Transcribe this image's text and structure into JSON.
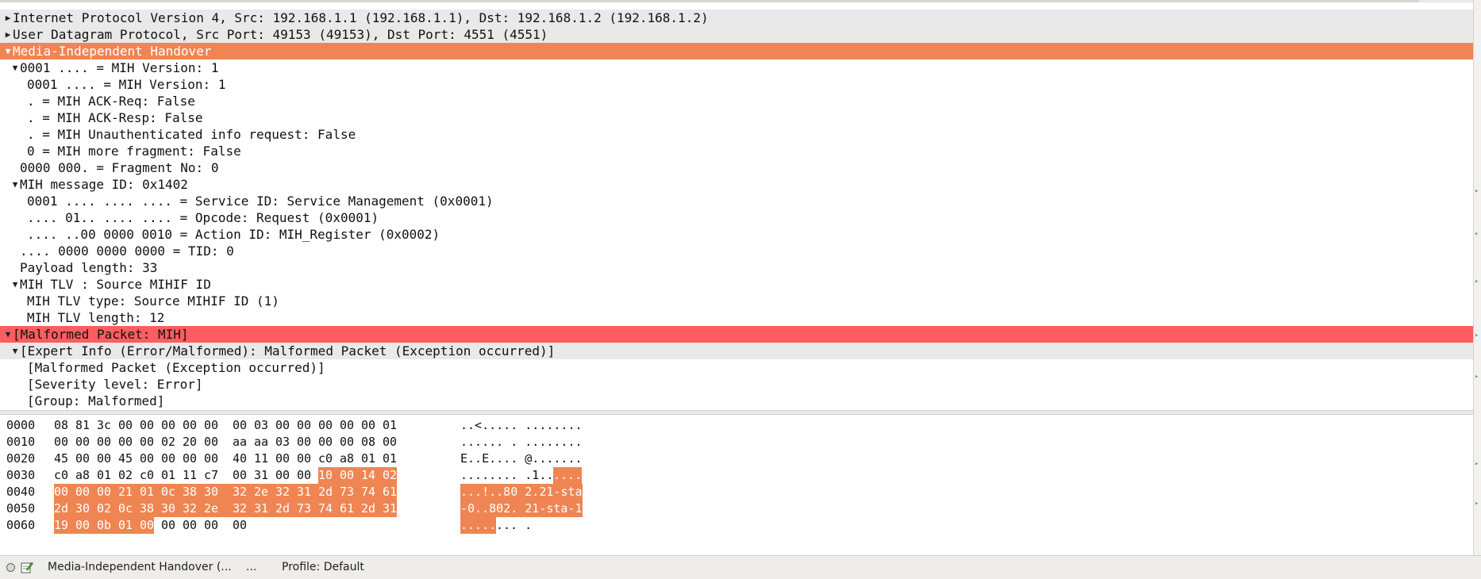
{
  "tree": [
    {
      "text": "Internet Protocol Version 4, Src: 192.168.1.1 (192.168.1.1), Dst: 192.168.1.2 (192.168.1.2)",
      "indent": 0,
      "toggle": "collapsed",
      "style": "gray"
    },
    {
      "text": "User Datagram Protocol, Src Port: 49153 (49153), Dst Port: 4551 (4551)",
      "indent": 0,
      "toggle": "collapsed",
      "style": "gray"
    },
    {
      "text": "Media-Independent Handover",
      "indent": 0,
      "toggle": "expanded",
      "style": "orange"
    },
    {
      "text": "0001 .... = MIH Version: 1",
      "indent": 1,
      "toggle": "expanded",
      "style": "plain"
    },
    {
      "text": "0001 .... = MIH Version: 1",
      "indent": 2,
      "toggle": "none",
      "style": "plain"
    },
    {
      "text": ". = MIH ACK-Req: False",
      "indent": 2,
      "toggle": "none",
      "style": "plain"
    },
    {
      "text": ". = MIH ACK-Resp: False",
      "indent": 2,
      "toggle": "none",
      "style": "plain"
    },
    {
      "text": ". = MIH Unauthenticated info request: False",
      "indent": 2,
      "toggle": "none",
      "style": "plain"
    },
    {
      "text": "0 = MIH more fragment: False",
      "indent": 2,
      "toggle": "none",
      "style": "plain"
    },
    {
      "text": "0000 000. = Fragment No: 0",
      "indent": 1,
      "toggle": "none",
      "style": "plain"
    },
    {
      "text": "MIH message ID: 0x1402",
      "indent": 1,
      "toggle": "expanded",
      "style": "plain"
    },
    {
      "text": "0001 .... .... .... = Service ID: Service Management (0x0001)",
      "indent": 2,
      "toggle": "none",
      "style": "plain"
    },
    {
      "text": ".... 01.. .... .... = Opcode: Request (0x0001)",
      "indent": 2,
      "toggle": "none",
      "style": "plain"
    },
    {
      "text": ".... ..00 0000 0010 = Action ID: MIH_Register (0x0002)",
      "indent": 2,
      "toggle": "none",
      "style": "plain"
    },
    {
      "text": ".... 0000 0000 0000 = TID: 0",
      "indent": 1,
      "toggle": "none",
      "style": "plain"
    },
    {
      "text": "Payload length: 33",
      "indent": 1,
      "toggle": "none",
      "style": "plain"
    },
    {
      "text": "MIH TLV : Source MIHIF ID",
      "indent": 1,
      "toggle": "expanded",
      "style": "plain"
    },
    {
      "text": "MIH TLV type: Source MIHIF ID (1)",
      "indent": 2,
      "toggle": "none",
      "style": "plain"
    },
    {
      "text": "MIH TLV length: 12",
      "indent": 2,
      "toggle": "none",
      "style": "plain"
    },
    {
      "text": "[Malformed Packet: MIH]",
      "indent": 0,
      "toggle": "expanded",
      "style": "red"
    },
    {
      "text": "[Expert Info (Error/Malformed): Malformed Packet (Exception occurred)]",
      "indent": 1,
      "toggle": "expanded",
      "style": "gray"
    },
    {
      "text": "[Malformed Packet (Exception occurred)]",
      "indent": 2,
      "toggle": "none",
      "style": "plain"
    },
    {
      "text": "[Severity level: Error]",
      "indent": 2,
      "toggle": "none",
      "style": "plain"
    },
    {
      "text": "[Group: Malformed]",
      "indent": 2,
      "toggle": "none",
      "style": "plain"
    }
  ],
  "hex_dump": [
    {
      "offset": "0000",
      "bytes": [
        "08",
        "81",
        "3c",
        "00",
        "00",
        "00",
        "00",
        "00",
        "00",
        "03",
        "00",
        "00",
        "00",
        "00",
        "00",
        "01"
      ],
      "ascii": "..<..... ........",
      "hl_start": -1
    },
    {
      "offset": "0010",
      "bytes": [
        "00",
        "00",
        "00",
        "00",
        "00",
        "02",
        "20",
        "00",
        "aa",
        "aa",
        "03",
        "00",
        "00",
        "00",
        "08",
        "00"
      ],
      "ascii": "...... . ........",
      "hl_start": -1
    },
    {
      "offset": "0020",
      "bytes": [
        "45",
        "00",
        "00",
        "45",
        "00",
        "00",
        "00",
        "00",
        "40",
        "11",
        "00",
        "00",
        "c0",
        "a8",
        "01",
        "01"
      ],
      "ascii": "E..E.... @.......",
      "hl_start": -1
    },
    {
      "offset": "0030",
      "bytes": [
        "c0",
        "a8",
        "01",
        "02",
        "c0",
        "01",
        "11",
        "c7",
        "00",
        "31",
        "00",
        "00",
        "10",
        "00",
        "14",
        "02"
      ],
      "ascii": "........ .1......",
      "hl_start": 12,
      "hl_end": 16
    },
    {
      "offset": "0040",
      "bytes": [
        "00",
        "00",
        "00",
        "21",
        "01",
        "0c",
        "38",
        "30",
        "32",
        "2e",
        "32",
        "31",
        "2d",
        "73",
        "74",
        "61"
      ],
      "ascii": "...!..80 2.21-sta",
      "hl_start": 0,
      "hl_end": 16
    },
    {
      "offset": "0050",
      "bytes": [
        "2d",
        "30",
        "02",
        "0c",
        "38",
        "30",
        "32",
        "2e",
        "32",
        "31",
        "2d",
        "73",
        "74",
        "61",
        "2d",
        "31"
      ],
      "ascii": "-0..802. 21-sta-1",
      "hl_start": 0,
      "hl_end": 16
    },
    {
      "offset": "0060",
      "bytes": [
        "19",
        "00",
        "0b",
        "01",
        "00",
        "00",
        "00",
        "00",
        "00"
      ],
      "ascii": "........ .",
      "hl_start": 0,
      "hl_end": 5
    }
  ],
  "statusbar": {
    "led_icon": "expert-info-led-icon",
    "edit_icon": "edit-comment-icon",
    "field_label": "Media-Independent Handover (...",
    "packets": "...",
    "profile": "Profile: Default"
  },
  "colors": {
    "highlight": "#ef8552",
    "malformed": "#fd5d5f",
    "row_gray": "#e9e9e9"
  }
}
